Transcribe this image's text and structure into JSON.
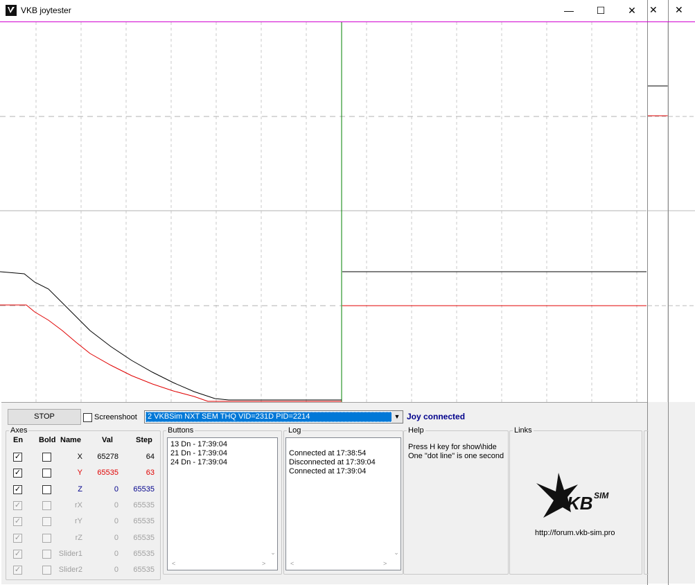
{
  "window": {
    "title": "VKB joytester"
  },
  "titlebar": {
    "minimize": "—",
    "maximize": "☐",
    "close": "✕",
    "ghost_close_1": "✕",
    "ghost_close_2": "✕"
  },
  "controls": {
    "stop_label": "STOP",
    "screenshot_label": "Screenshoot",
    "screenshot_checked": false,
    "device_selected": "2  VKBSim NXT SEM THQ  VID=231D PID=2214",
    "status": "Joy connected"
  },
  "axes": {
    "title": "Axes",
    "headers": {
      "en": "En",
      "bold": "Bold",
      "name": "Name",
      "val": "Val",
      "step": "Step"
    },
    "rows": [
      {
        "name": "X",
        "val": "65278",
        "step": "64",
        "en": true,
        "enabled": true,
        "color": "#000000"
      },
      {
        "name": "Y",
        "val": "65535",
        "step": "63",
        "en": true,
        "enabled": true,
        "color": "#e00000"
      },
      {
        "name": "Z",
        "val": "0",
        "step": "65535",
        "en": true,
        "enabled": true,
        "color": "#00008b"
      },
      {
        "name": "rX",
        "val": "0",
        "step": "65535",
        "en": true,
        "enabled": false,
        "color": "#a0a0a0"
      },
      {
        "name": "rY",
        "val": "0",
        "step": "65535",
        "en": true,
        "enabled": false,
        "color": "#a0a0a0"
      },
      {
        "name": "rZ",
        "val": "0",
        "step": "65535",
        "en": true,
        "enabled": false,
        "color": "#a0a0a0"
      },
      {
        "name": "Slider1",
        "val": "0",
        "step": "65535",
        "en": true,
        "enabled": false,
        "color": "#a0a0a0"
      },
      {
        "name": "Slider2",
        "val": "0",
        "step": "65535",
        "en": true,
        "enabled": false,
        "color": "#a0a0a0"
      }
    ]
  },
  "buttons_group": {
    "title": "Buttons",
    "items": [
      "13 Dn - 17:39:04",
      "21 Dn - 17:39:04",
      "24 Dn - 17:39:04"
    ]
  },
  "log_group": {
    "title": "Log",
    "items": [
      "Connected at 17:38:54",
      "Disconnected at 17:39:04",
      "Connected at 17:39:04"
    ]
  },
  "help_group": {
    "title": "Help",
    "lines": [
      "Press H key for show\\hide",
      "One \"dot line\" is one second"
    ]
  },
  "links_group": {
    "title": "Links",
    "logo_text": "VKBSIM",
    "url": "http://forum.vkb-sim.pro"
  },
  "colors": {
    "accent": "#0078d7",
    "status": "#00008b",
    "x_trace": "#000000",
    "y_trace": "#e00000",
    "cursor": "#008000",
    "top_line": "#d000d0"
  }
}
